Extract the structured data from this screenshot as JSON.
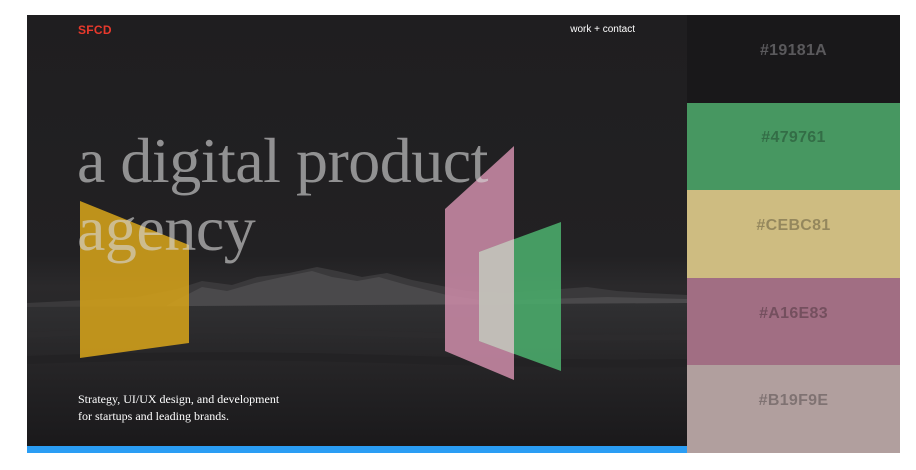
{
  "site": {
    "logo": "SFCD",
    "nav": "work + contact",
    "headline": [
      "a digital product",
      "agency"
    ],
    "tagline": [
      "Strategy, UI/UX design, and development",
      "for startups and leading brands."
    ]
  },
  "palette": [
    {
      "label": "#19181A",
      "color": "#19181A"
    },
    {
      "label": "#479761",
      "color": "#479761"
    },
    {
      "label": "#CEBC81",
      "color": "#CEBC81"
    },
    {
      "label": "#A16E83",
      "color": "#A16E83"
    },
    {
      "label": "#B19F9E",
      "color": "#B19F9E"
    }
  ],
  "colors": {
    "hero_bg": "#1c1b1d",
    "logo": "#e8392c",
    "accent_bar": "#2a9df4",
    "shape_yellow": "#d4a21a",
    "shape_pink": "#c98aa6",
    "shape_green": "#4aaa6a"
  },
  "icons": [
    "mountain-landscape-image"
  ]
}
